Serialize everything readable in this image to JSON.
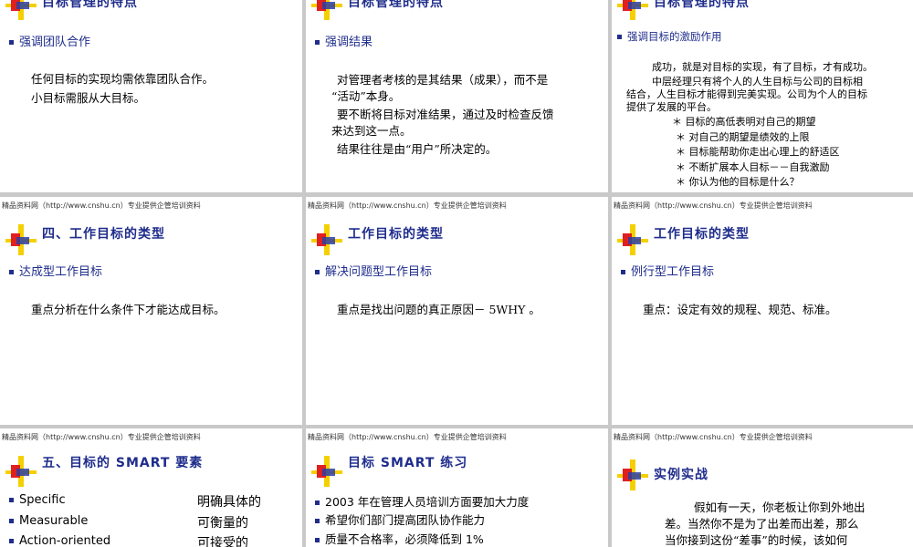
{
  "footer_text": "精品资料网（http://www.cnshu.cn）专业提供企管培训资料",
  "slides": {
    "s1": {
      "title": "目标管理的特点",
      "bullet": "强调团队合作",
      "lines": [
        "任何目标的实现均需依靠团队合作。",
        "小目标需服从大目标。"
      ]
    },
    "s2": {
      "title": "目标管理的特点",
      "bullet": "强调结果",
      "lines": [
        "对管理者考核的是其结果（成果），而不是",
        "“活动”本身。",
        "要不断将目标对准结果，通过及时检查反馈",
        "来达到这一点。",
        "结果往往是由“用户”所决定的。"
      ]
    },
    "s3": {
      "title": "目标管理的特点",
      "bullet": "强调目标的激励作用",
      "lines": [
        "成功，就是对目标的实现，有了目标，才有成功。",
        "中层经理只有将个人的人生目标与公司的目标相",
        "结合，人生目标才能得到完美实现。公司为个人的目标",
        "提供了发展的平台。"
      ],
      "stars": [
        "＊ 目标的高低表明对自己的期望",
        "＊ 对自己的期望是绩效的上限",
        "＊ 目标能帮助你走出心理上的舒适区",
        "＊ 不断扩展本人目标－－自我激励",
        "＊ 你认为他的目标是什么？"
      ]
    },
    "s4": {
      "title": "四、工作目标的类型",
      "bullet": "达成型工作目标",
      "lines": [
        "重点分析在什么条件下才能达成目标。"
      ]
    },
    "s5": {
      "title": "工作目标的类型",
      "bullet": "解决问题型工作目标",
      "lines": [
        "重点是找出问题的真正原因－ 5WHY 。"
      ]
    },
    "s6": {
      "title": "工作目标的类型",
      "bullet": "例行型工作目标",
      "lines": [
        "重点：设定有效的规程、规范、标准。"
      ]
    },
    "s7": {
      "title": "五、目标的 SMART 要素",
      "items": [
        {
          "en": "Specific",
          "cn": "明确具体的"
        },
        {
          "en": "Measurable",
          "cn": "可衡量的"
        },
        {
          "en": "Action-oriented",
          "cn": "可接受的"
        }
      ]
    },
    "s8": {
      "title": "目标 SMART 练习",
      "items": [
        "2003 年在管理人员培训方面要加大力度",
        "希望你们部门提高团队协作能力",
        "质量不合格率，必须降低到 1%"
      ]
    },
    "s9": {
      "title": "实例实战",
      "lines": [
        "假如有一天，你老板让你到外地出",
        "差。当然你不是为了出差而出差，那么",
        "当你接到这份“差事”的时候，该如何"
      ]
    }
  }
}
